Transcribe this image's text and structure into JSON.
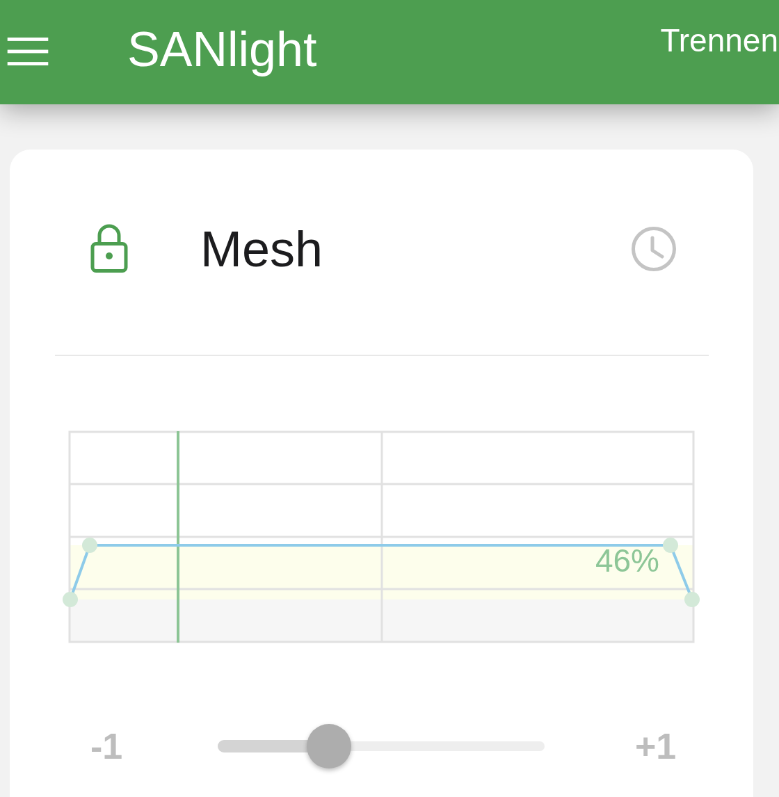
{
  "app_bar": {
    "title": "SANlight",
    "action": "Trennen"
  },
  "card": {
    "title": "Mesh"
  },
  "chart": {
    "value_label": "46%"
  },
  "slider": {
    "min_label": "-1",
    "max_label": "+1",
    "level": 0.34
  }
}
